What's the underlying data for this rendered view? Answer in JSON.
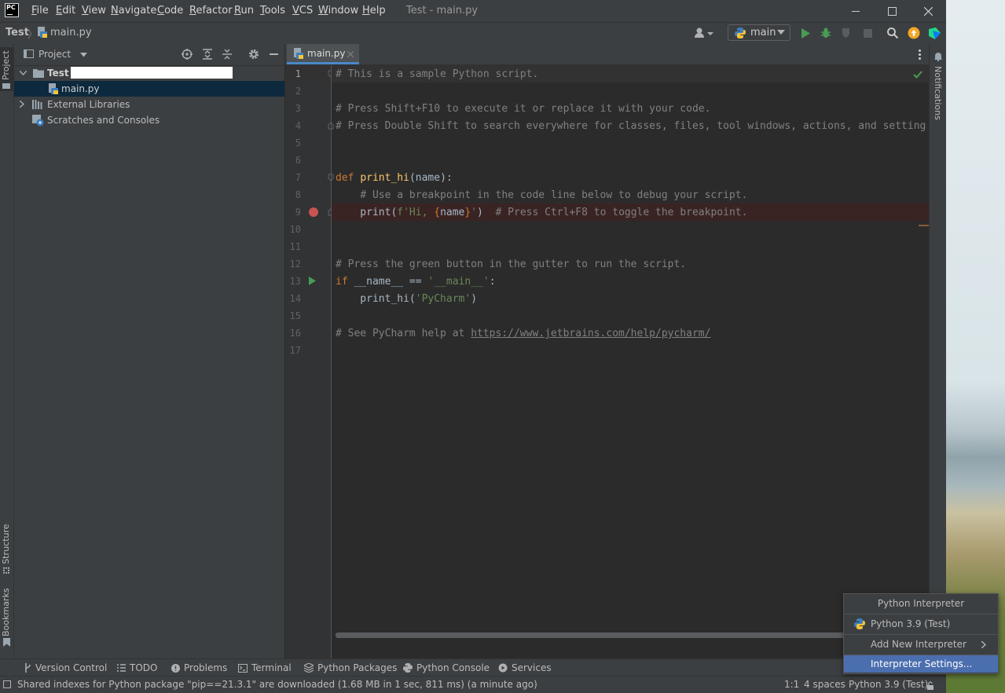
{
  "window": {
    "title": "Test - main.py",
    "app_icon": "PC",
    "menu": [
      "File",
      "Edit",
      "View",
      "Navigate",
      "Code",
      "Refactor",
      "Run",
      "Tools",
      "VCS",
      "Window",
      "Help"
    ]
  },
  "navbar": {
    "breadcrumb_project": "Test",
    "breadcrumb_file": "main.py",
    "run_config": "main"
  },
  "left_strip": {
    "project": "Project",
    "structure": "Structure",
    "bookmarks": "Bookmarks"
  },
  "project_panel": {
    "title": "Project",
    "tree": [
      {
        "label": "Test",
        "icon": "folder-icon",
        "expanded": true
      },
      {
        "label": "main.py",
        "icon": "python-file-icon",
        "selected": true
      },
      {
        "label": "External Libraries",
        "icon": "library-icon",
        "expanded": false
      },
      {
        "label": "Scratches and Consoles",
        "icon": "scratch-icon"
      }
    ]
  },
  "editor": {
    "tab": "main.py",
    "line_numbers": [
      "1",
      "2",
      "3",
      "4",
      "5",
      "6",
      "7",
      "8",
      "9",
      "10",
      "11",
      "12",
      "13",
      "14",
      "15",
      "16",
      "17"
    ],
    "breakpoint_line": 9,
    "run_marker_line": 13
  },
  "right_strip": {
    "notifications": "Notifications"
  },
  "tool_windows": [
    "Version Control",
    "TODO",
    "Problems",
    "Terminal",
    "Python Packages",
    "Python Console",
    "Services"
  ],
  "status": {
    "message": "Shared indexes for Python package \"pip==21.3.1\" are downloaded (1.68 MB in 1 sec, 811 ms) (a minute ago)",
    "position": "1:1",
    "indent": "4 spaces",
    "interpreter": "Python 3.9 (Test)"
  },
  "interpreter_popup": {
    "title": "Python Interpreter",
    "items": [
      "Python 3.9 (Test)",
      "Add New Interpreter",
      "Interpreter Settings..."
    ],
    "highlighted_index": 2
  },
  "colors": {
    "accent": "#4b6eaf",
    "selection": "#0d293e",
    "breakpoint_line": "#3a2323",
    "run_green": "#499c54"
  }
}
